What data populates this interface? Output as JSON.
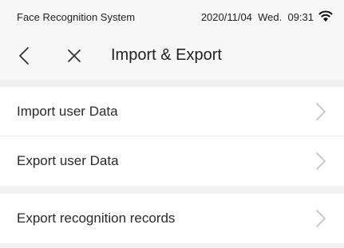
{
  "status_bar": {
    "app_name": "Face Recognition System",
    "datetime": "2020/11/04  Wed.  09:31",
    "wifi_icon": "wifi-icon"
  },
  "nav": {
    "back_icon": "chevron-left-icon",
    "close_icon": "close-icon",
    "title": "Import & Export"
  },
  "menu": {
    "group1": [
      {
        "label": "Import user Data",
        "icon": "chevron-right-icon"
      },
      {
        "label": "Export user Data",
        "icon": "chevron-right-icon"
      }
    ],
    "group2": [
      {
        "label": "Export recognition records",
        "icon": "chevron-right-icon"
      }
    ]
  },
  "colors": {
    "background": "#f1f1f1",
    "header_background": "#f7f7f7",
    "row_background": "#ffffff",
    "divider": "#ececec",
    "text": "#222222",
    "chevron": "#c2c2c2"
  }
}
